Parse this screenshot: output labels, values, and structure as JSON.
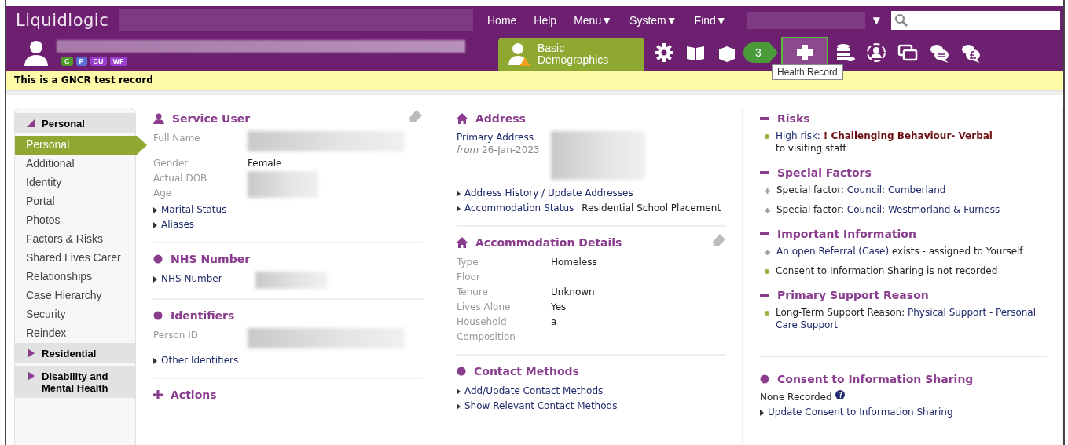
{
  "header": {
    "logo": "Liquidlogic",
    "nav": [
      {
        "label": "Home"
      },
      {
        "label": "Help"
      },
      {
        "label": "Menu",
        "caret": "▼"
      },
      {
        "label": "System",
        "caret": "▼"
      },
      {
        "label": "Find",
        "caret": "▼"
      }
    ],
    "team_caret": "▼"
  },
  "person_bar": {
    "badges": [
      {
        "label": "C",
        "color": "#4e9a2a"
      },
      {
        "label": "P",
        "color": "#5b6fd6"
      },
      {
        "label": "CU",
        "color": "#9b3fcf"
      },
      {
        "label": "WF",
        "color": "#9b3fcf"
      }
    ],
    "tab": "Basic Demographics",
    "toolbar": [
      {
        "kind": "gear",
        "selected": false
      },
      {
        "kind": "book",
        "selected": false
      },
      {
        "kind": "box",
        "selected": false
      },
      {
        "kind": "health",
        "selected": true
      },
      {
        "kind": "coins",
        "selected": false
      },
      {
        "kind": "person-ring",
        "selected": false
      },
      {
        "kind": "windows",
        "selected": false
      },
      {
        "kind": "speech",
        "selected": false
      },
      {
        "kind": "money-speech",
        "selected": false
      }
    ],
    "step_badge": "3",
    "tooltip": "Health Record"
  },
  "banner": "This is a GNCR test record",
  "sidebar": [
    {
      "label": "Personal",
      "expanded": true,
      "items": [
        {
          "label": "Personal",
          "selected": true
        },
        {
          "label": "Additional",
          "selected": false
        },
        {
          "label": "Identity",
          "selected": false
        },
        {
          "label": "Portal",
          "selected": false
        },
        {
          "label": "Photos",
          "selected": false
        },
        {
          "label": "Factors & Risks",
          "selected": false
        },
        {
          "label": "Shared Lives Carer",
          "selected": false
        },
        {
          "label": "Relationships",
          "selected": false
        },
        {
          "label": "Case Hierarchy",
          "selected": false
        },
        {
          "label": "Security",
          "selected": false
        },
        {
          "label": "Reindex",
          "selected": false
        }
      ]
    },
    {
      "label": "Residential",
      "expanded": false
    },
    {
      "label": "Disability and Mental Health",
      "expanded": false
    }
  ],
  "columns": [
    [
      {
        "title": "Service User",
        "kind": "person",
        "editable": true,
        "rows": [
          {
            "kind": "redacted",
            "labels": [
              "Full Name"
            ]
          },
          {
            "kind": "field",
            "label": "Gender",
            "value": "Female"
          },
          {
            "kind": "redacted",
            "labels": [
              "Actual DOB",
              "Age"
            ]
          },
          {
            "kind": "link",
            "label": "Marital Status"
          },
          {
            "kind": "link",
            "label": "Aliases"
          }
        ]
      },
      {
        "title": "NHS Number",
        "kind": "dot",
        "editable": false,
        "rows": [
          {
            "kind": "link-redacted",
            "label": "NHS Number"
          }
        ]
      },
      {
        "title": "Identifiers",
        "kind": "dot",
        "editable": false,
        "rows": [
          {
            "kind": "redacted",
            "labels": [
              "Person ID"
            ]
          },
          {
            "kind": "link",
            "label": "Other Identifiers"
          }
        ]
      },
      {
        "title": "Actions",
        "kind": "plus",
        "editable": false
      }
    ],
    [
      {
        "title": "Address",
        "kind": "home",
        "editable": false,
        "rows": [
          {
            "kind": "address",
            "label": "Primary Address",
            "note": "*from* 26-Jan-2023"
          },
          {
            "kind": "link",
            "label": "Address History / Update Addresses"
          },
          {
            "kind": "link",
            "label": "Accommodation Status",
            "value": "Residential School Placement"
          }
        ]
      },
      {
        "title": "Accommodation Details",
        "kind": "home",
        "editable": true,
        "rows": [
          {
            "kind": "field",
            "label": "Type",
            "value": "Homeless"
          },
          {
            "kind": "field",
            "label": "Floor"
          },
          {
            "kind": "field",
            "label": "Tenure",
            "value": "Unknown"
          },
          {
            "kind": "field",
            "label": "Lives Alone",
            "value": "Yes"
          },
          {
            "kind": "field",
            "label": "Household Composition",
            "value": "a"
          }
        ]
      },
      {
        "title": "Contact Methods",
        "kind": "dot",
        "editable": false,
        "rows": [
          {
            "kind": "link",
            "label": "Add/Update Contact Methods"
          },
          {
            "kind": "link",
            "label": "Show Relevant Contact Methods"
          }
        ]
      }
    ],
    [
      {
        "title": "Risks",
        "kind": "minus",
        "editable": false,
        "rows": [
          {
            "kind": "dot-item",
            "parts": [
              {
                "text": "High risk: ",
                "kind": "link"
              },
              {
                "text": "! Challenging Behaviour- Verbal",
                "kind": "alert"
              },
              {
                "text": "to visiting staff",
                "kind": "line"
              }
            ]
          }
        ]
      },
      {
        "title": "Special Factors",
        "kind": "minus",
        "editable": false,
        "rows": [
          {
            "kind": "plus-item",
            "parts": [
              {
                "text": "Special factor: ",
                "kind": "plain"
              },
              {
                "text": "Council: Cumberland",
                "kind": "link"
              }
            ]
          },
          {
            "kind": "plus-item",
            "parts": [
              {
                "text": "Special factor: ",
                "kind": "plain"
              },
              {
                "text": "Council: Westmorland & Furness",
                "kind": "link"
              }
            ]
          }
        ]
      },
      {
        "title": "Important Information",
        "kind": "minus",
        "editable": false,
        "rows": [
          {
            "kind": "plus-item",
            "parts": [
              {
                "text": "An open Referral (Case)",
                "kind": "link"
              },
              {
                "text": " exists - assigned to Yourself",
                "kind": "plain"
              }
            ]
          },
          {
            "kind": "dot-item",
            "parts": [
              {
                "text": "Consent to Information Sharing is not recorded",
                "kind": "plain"
              }
            ]
          }
        ]
      },
      {
        "title": "Primary Support Reason",
        "kind": "minus",
        "editable": false,
        "rows": [
          {
            "kind": "dot-item",
            "parts": [
              {
                "text": "Long-Term Support Reason: ",
                "kind": "plain"
              },
              {
                "text": "Physical Support - Personal Care Support",
                "kind": "link"
              }
            ]
          }
        ]
      },
      {
        "title": "Consent to Information Sharing",
        "kind": "dot",
        "editable": false,
        "divider": true,
        "rows": [
          {
            "kind": "help-text",
            "label": "None Recorded"
          },
          {
            "kind": "link",
            "label": "Update Consent to Information Sharing"
          }
        ]
      }
    ]
  ]
}
